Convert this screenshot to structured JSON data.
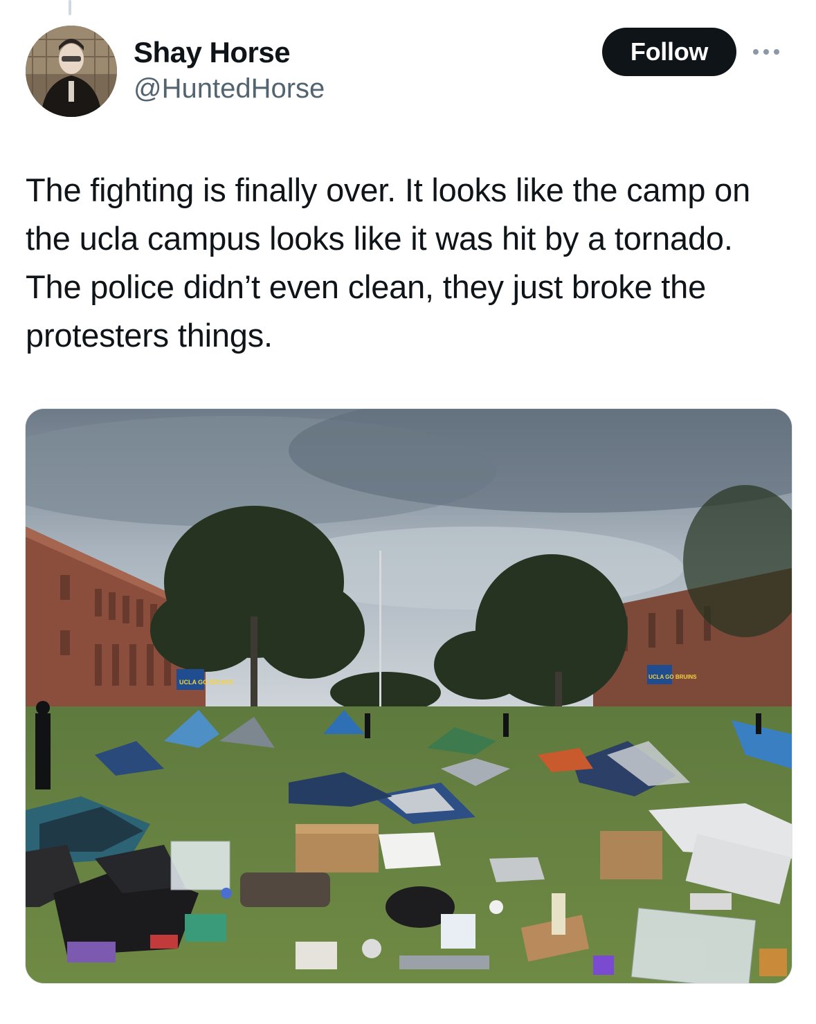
{
  "tweet": {
    "author": {
      "display_name": "Shay Horse",
      "handle": "@HuntedHorse",
      "avatar_icon": "profile-avatar"
    },
    "follow_label": "Follow",
    "more_icon": "more-options-icon",
    "text": "The fighting is finally over. It looks like the camp on the ucla campus looks like it was hit by a tornado. The police didn’t even clean, they just broke the protesters things.",
    "media": {
      "type": "photo",
      "banner_text_left": "UCLA GO BRUINS",
      "banner_text_right": "UCLA GO BRUINS"
    }
  },
  "colors": {
    "text_primary": "#0f1419",
    "text_secondary": "#536471",
    "follow_bg": "#0f1419",
    "follow_text": "#ffffff",
    "thread_line": "#cfd9de"
  }
}
